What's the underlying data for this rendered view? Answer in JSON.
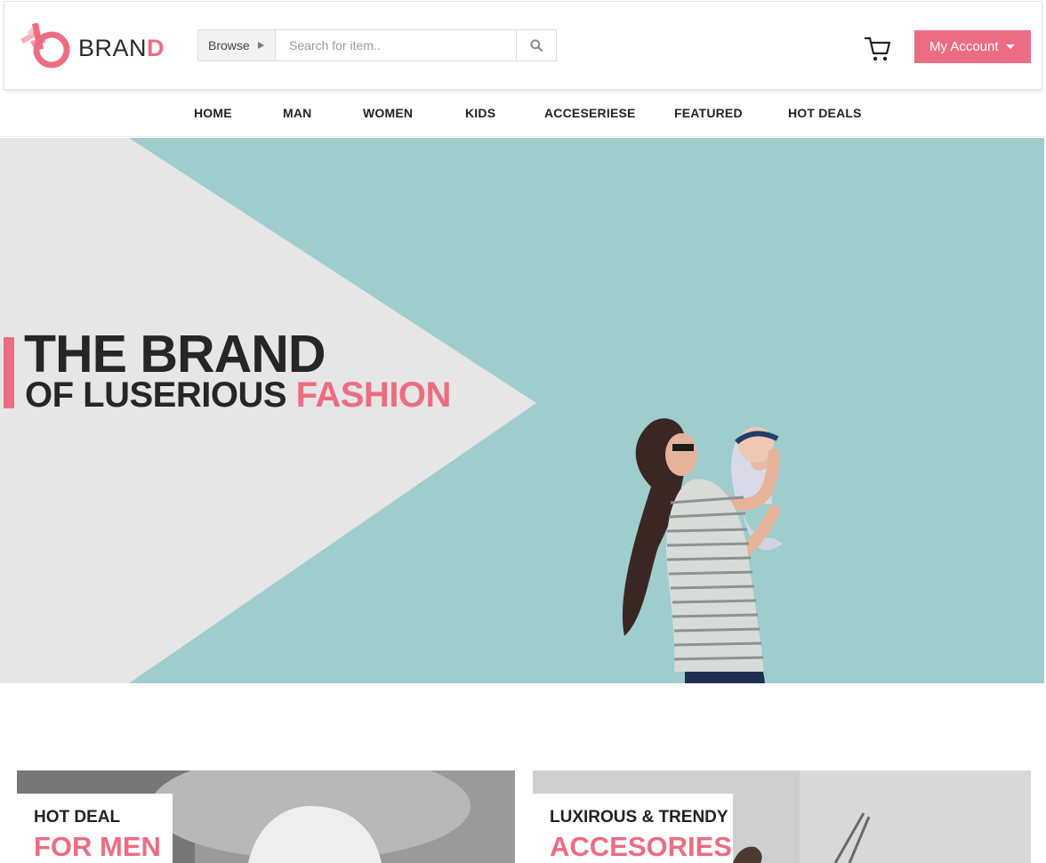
{
  "header": {
    "logo_text_main": "BRAN",
    "logo_text_accent": "D",
    "browse_label": "Browse",
    "search_placeholder": "Search for item..",
    "search_value": "",
    "account_label": "My Account",
    "accent_color": "#ec6d83"
  },
  "nav": {
    "items": [
      {
        "label": "HOME"
      },
      {
        "label": "MAN"
      },
      {
        "label": "WOMEN"
      },
      {
        "label": "KIDS"
      },
      {
        "label": "ACCESERIESE"
      },
      {
        "label": "FEATURED"
      },
      {
        "label": "HOT DEALS"
      }
    ]
  },
  "hero": {
    "line1": "THE BRAND",
    "line2_dark": "OF LUSERIOUS ",
    "line2_pink": "FASHION",
    "background_color": "#9fcccd"
  },
  "promos": [
    {
      "small": "HOT DEAL",
      "big": "FOR MEN"
    },
    {
      "small": "LUXIROUS & TRENDY",
      "big": "ACCESORIES"
    }
  ],
  "icons": {
    "logo": "brand-logo-icon",
    "search": "search-icon",
    "cart": "cart-icon",
    "browse_caret": "caret-right-icon",
    "account_caret": "caret-down-icon"
  }
}
